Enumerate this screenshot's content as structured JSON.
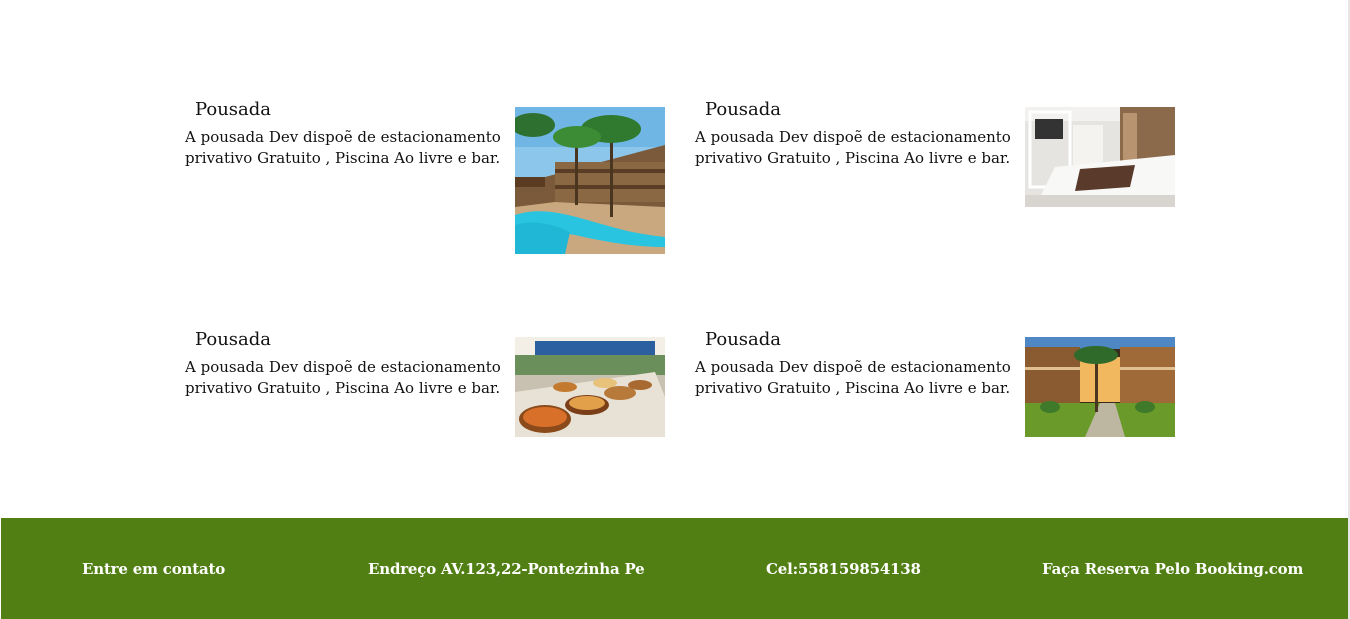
{
  "cards": [
    {
      "title": "Pousada",
      "text": "A pousada Dev dispoẽ de estacionamento privativo Gratuito , Piscina Ao livre e bar.",
      "image": "pool-resort-photo"
    },
    {
      "title": "Pousada",
      "text": "A pousada Dev dispoẽ de estacionamento privativo Gratuito , Piscina Ao livre e bar.",
      "image": "hotel-room-photo"
    },
    {
      "title": "Pousada",
      "text": "A pousada Dev dispoẽ de estacionamento privativo Gratuito , Piscina Ao livre e bar.",
      "image": "breakfast-buffet-photo"
    },
    {
      "title": "Pousada",
      "text": "A pousada Dev dispoẽ de estacionamento privativo Gratuito , Piscina Ao livre e bar.",
      "image": "courtyard-garden-photo"
    }
  ],
  "footer": {
    "contact": "Entre em contato",
    "address": "Endreço AV.123,22-Pontezinha Pe",
    "phone": "Cel:558159854138",
    "booking": "Faça Reserva Pelo Booking.com",
    "background_color": "#527f14"
  }
}
